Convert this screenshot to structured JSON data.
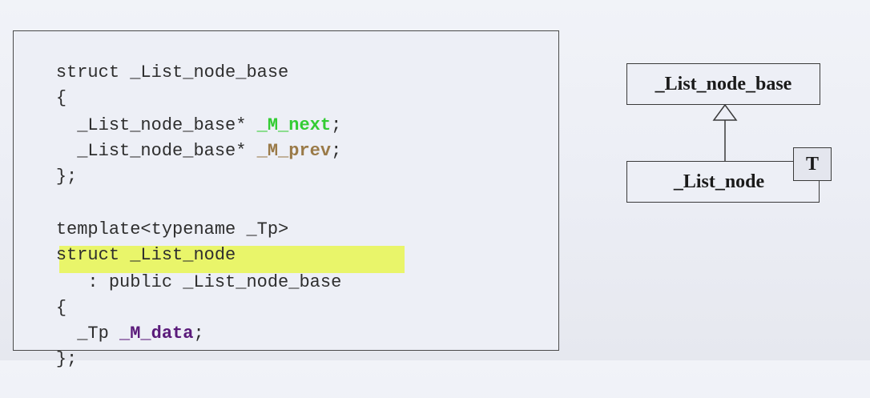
{
  "code": {
    "base_struct": {
      "header": "struct _List_node_base",
      "open_brace": "{",
      "next_type": "  _List_node_base* ",
      "next_field": "_M_next",
      "next_semicolon": ";",
      "prev_type": "  _List_node_base* ",
      "prev_field": "_M_prev",
      "prev_semicolon": ";",
      "close_brace": "};"
    },
    "node_struct": {
      "template_line": "template<typename _Tp>",
      "header": "struct _List_node",
      "inheritance": "   : public _List_node_base",
      "open_brace": "{",
      "data_type": "  _Tp ",
      "data_field": "_M_data",
      "data_semicolon": ";",
      "close_brace": "};"
    }
  },
  "colors": {
    "code_text": "#2e2e2e",
    "next_field": "#33cc33",
    "prev_field": "#9a7a48",
    "data_field": "#5a1a7a",
    "highlight": "#e9f56a"
  },
  "uml": {
    "base_class": "_List_node_base",
    "derived_class": "_List_node",
    "template_param": "T",
    "relationship": "inheritance"
  }
}
